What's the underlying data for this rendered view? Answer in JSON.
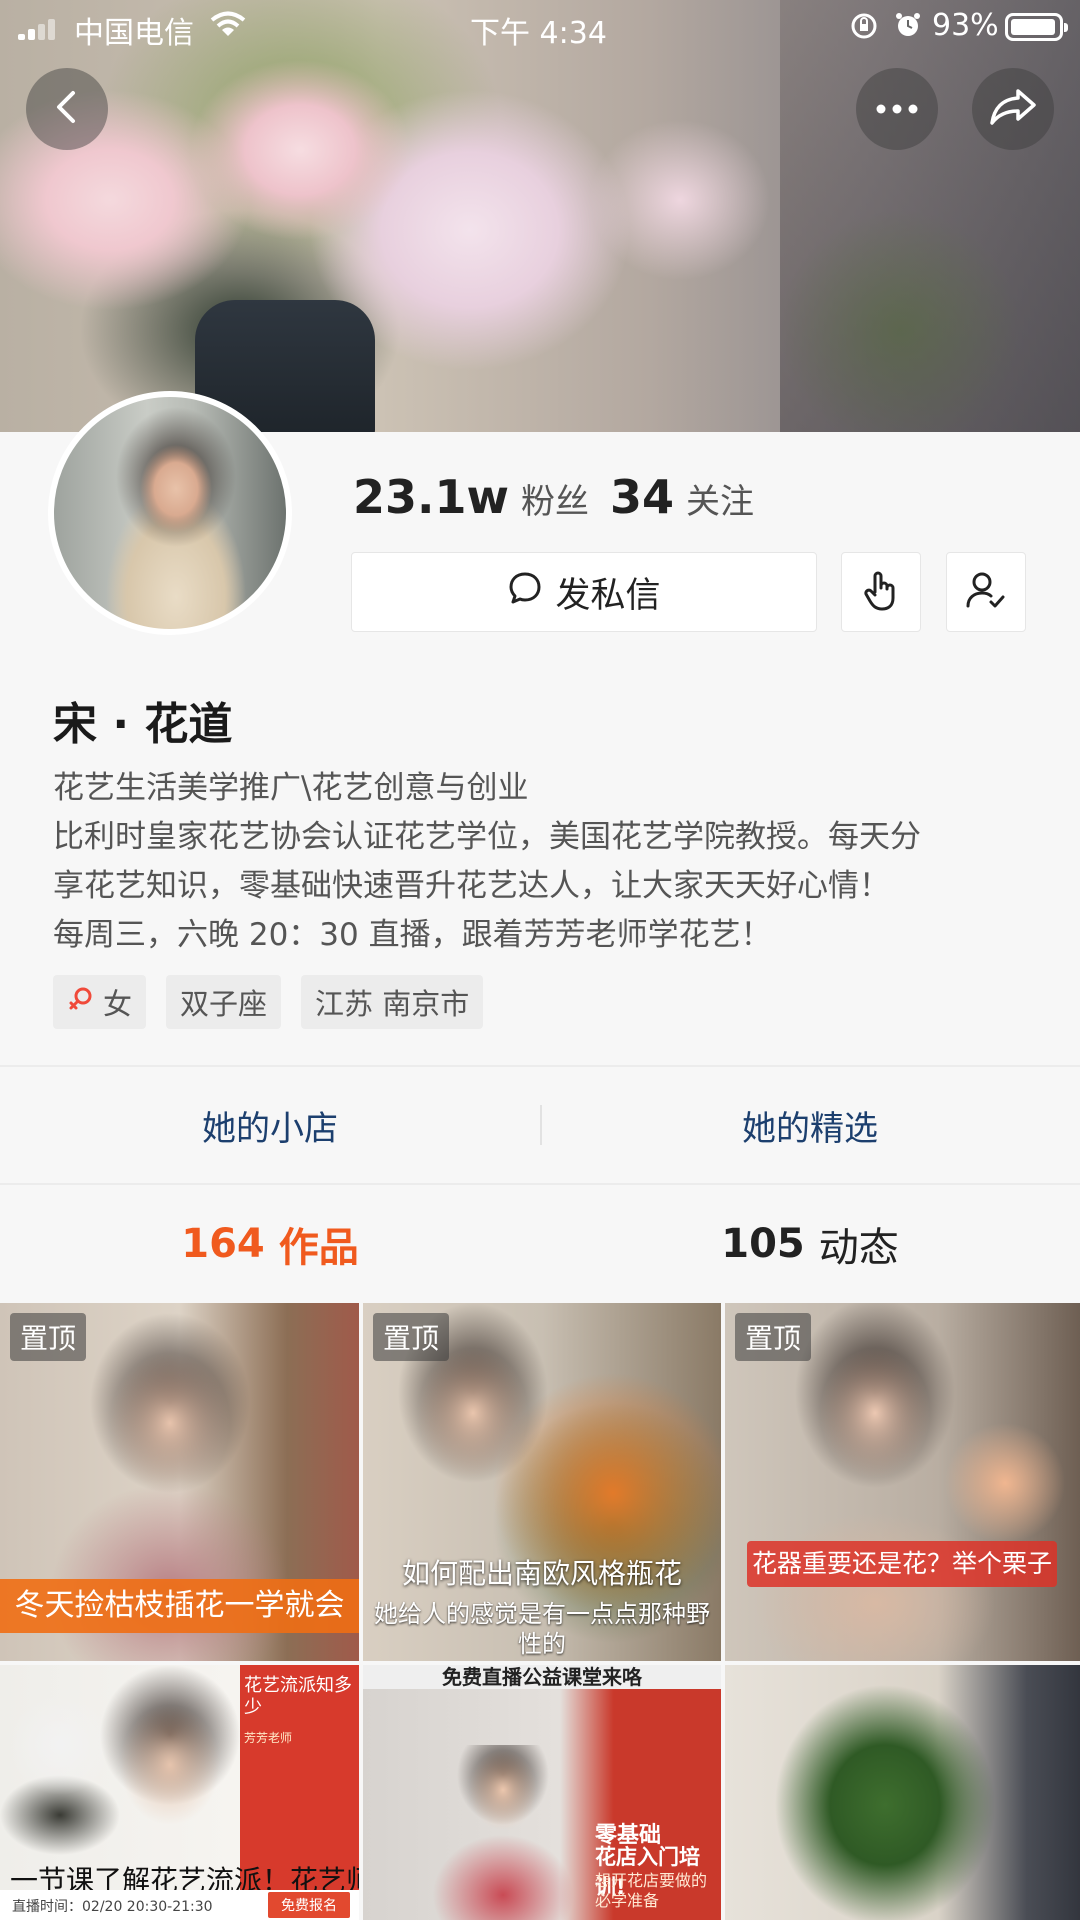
{
  "status_bar": {
    "carrier": "中国电信",
    "time": "下午 4:34",
    "battery": "93%"
  },
  "icons": {
    "back": "chevron-left-icon",
    "more": "more-dots-icon",
    "share": "share-icon",
    "message": "chat-bubble-icon",
    "tap": "hand-tap-icon",
    "follow": "user-check-icon",
    "gender": "female-icon"
  },
  "profile": {
    "followers_count": "23.1w",
    "followers_label": "粉丝",
    "following_count": "34",
    "following_label": "关注",
    "message_button": "发私信",
    "name": "宋 · 花道",
    "bio": [
      "花艺生活美学推广\\花艺创意与创业",
      "比利时皇家花艺协会认证花艺学位，美国花艺学院教授。每天分",
      "享花艺知识，零基础快速晋升花艺达人，让大家天天好心情！",
      "每周三，六晚 20：30 直播，跟着芳芳老师学花艺！"
    ],
    "tags": {
      "gender": "女",
      "zodiac": "双子座",
      "location": "江苏 南京市"
    }
  },
  "links": {
    "shop": "她的小店",
    "picks": "她的精选"
  },
  "tabs": {
    "works_count": "164",
    "works_label": "作品",
    "posts_count": "105",
    "posts_label": "动态"
  },
  "colors": {
    "accent": "#f05a1e",
    "link": "#1c3f6e"
  },
  "videos": [
    {
      "pin": "置顶",
      "caption": "冬天捡枯枝插花一学就会"
    },
    {
      "pin": "置顶",
      "caption": "如何配出南欧风格瓶花",
      "subtitle": "她给人的感觉是有一点点那种野性的"
    },
    {
      "pin": "置顶",
      "caption": "花器重要还是花？举个栗子"
    },
    {
      "badge_title": "花艺流派知多少",
      "badge_small": "芳芳老师",
      "title": "一节课了解花艺流派！花艺师必看",
      "live_time": "直播时间：02/20 20:30-21:30",
      "signup": "免费报名"
    },
    {
      "banner": "免费直播公益课堂来咯",
      "line1": "零基础",
      "line2": "花店入门培训!",
      "line3": "想开花店要做的必学准备"
    },
    {}
  ]
}
